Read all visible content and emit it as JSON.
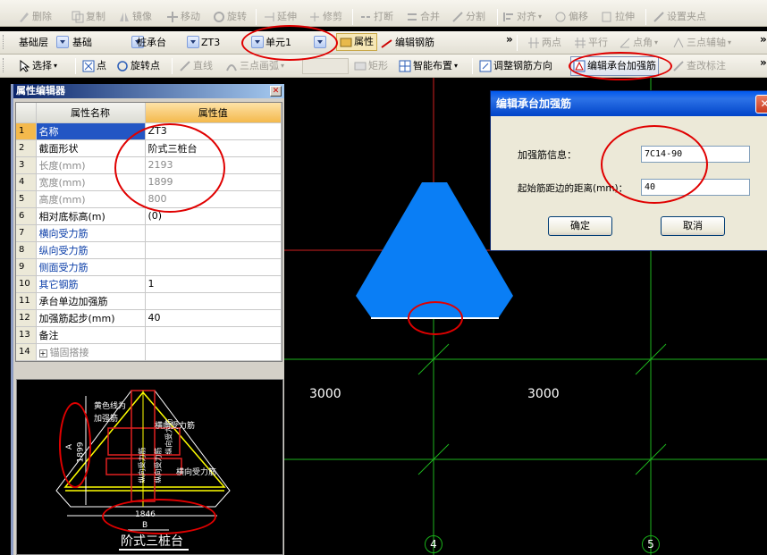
{
  "toolbar1": {
    "items": [
      "删除",
      "复制",
      "镜像",
      "移动",
      "旋转",
      "延伸",
      "修剪",
      "打断",
      "合并",
      "分割",
      "对齐",
      "偏移",
      "拉伸",
      "设置夹点"
    ]
  },
  "toolbar2": {
    "floor": "基础层",
    "category": "基础",
    "type": "桩承台",
    "component": "ZT3",
    "unit": "单元1",
    "props_btn": "属性",
    "edit_rebar_btn": "编辑钢筋",
    "two_point": "两点",
    "parallel": "平行",
    "point_angle": "点角",
    "three_point_aux": "三点辅轴"
  },
  "toolbar3": {
    "select": "选择",
    "point": "点",
    "rotate_point": "旋转点",
    "line": "直线",
    "three_point_arc": "三点画弧",
    "rect": "矩形",
    "smart_layout": "智能布置",
    "adjust_dir": "调整钢筋方向",
    "edit_strengthen": "编辑承台加强筋",
    "view_annot": "查改标注"
  },
  "panel": {
    "title": "属性编辑器",
    "col_name": "属性名称",
    "col_value": "属性值",
    "rows": [
      {
        "n": "1",
        "name": "名称",
        "value": "ZT3",
        "style": "sel"
      },
      {
        "n": "2",
        "name": "截面形状",
        "value": "阶式三桩台",
        "style": ""
      },
      {
        "n": "3",
        "name": "长度(mm)",
        "value": "2193",
        "style": "gray"
      },
      {
        "n": "4",
        "name": "宽度(mm)",
        "value": "1899",
        "style": "gray"
      },
      {
        "n": "5",
        "name": "高度(mm)",
        "value": "800",
        "style": "gray"
      },
      {
        "n": "6",
        "name": "相对底标高(m)",
        "value": "(0)",
        "style": ""
      },
      {
        "n": "7",
        "name": "横向受力筋",
        "value": "",
        "style": "blue"
      },
      {
        "n": "8",
        "name": "纵向受力筋",
        "value": "",
        "style": "blue"
      },
      {
        "n": "9",
        "name": "侧面受力筋",
        "value": "",
        "style": "blue"
      },
      {
        "n": "10",
        "name": "其它钢筋",
        "value": "1",
        "style": "blue"
      },
      {
        "n": "11",
        "name": "承台单边加强筋",
        "value": "",
        "style": ""
      },
      {
        "n": "12",
        "name": "加强筋起步(mm)",
        "value": "40",
        "style": ""
      },
      {
        "n": "13",
        "name": "备注",
        "value": "",
        "style": ""
      },
      {
        "n": "14",
        "name": "锚固搭接",
        "value": "",
        "style": "gray"
      }
    ]
  },
  "preview": {
    "note1": "黄色线为",
    "note2": "加强筋",
    "dim_a": "A",
    "dim_1899": "1899",
    "dim_1846": "1846",
    "dim_b": "B",
    "h_rebar1": "横向受力筋",
    "h_rebar2": "横向受力筋",
    "v_rebar1": "纵向受力筋",
    "v_rebar2": "纵向受力筋",
    "v_rebar3": "纵向受力筋",
    "caption": "阶式三桩台"
  },
  "dialog": {
    "title": "编辑承台加强筋",
    "label1": "加强筋信息：",
    "value1": "7C14-90",
    "label2": "起始筋距边的距离(mm)：",
    "value2": "40",
    "ok": "确定",
    "cancel": "取消"
  },
  "cad": {
    "dim_left": "3000",
    "dim_right": "3000",
    "axis4": "4",
    "axis5": "5"
  }
}
